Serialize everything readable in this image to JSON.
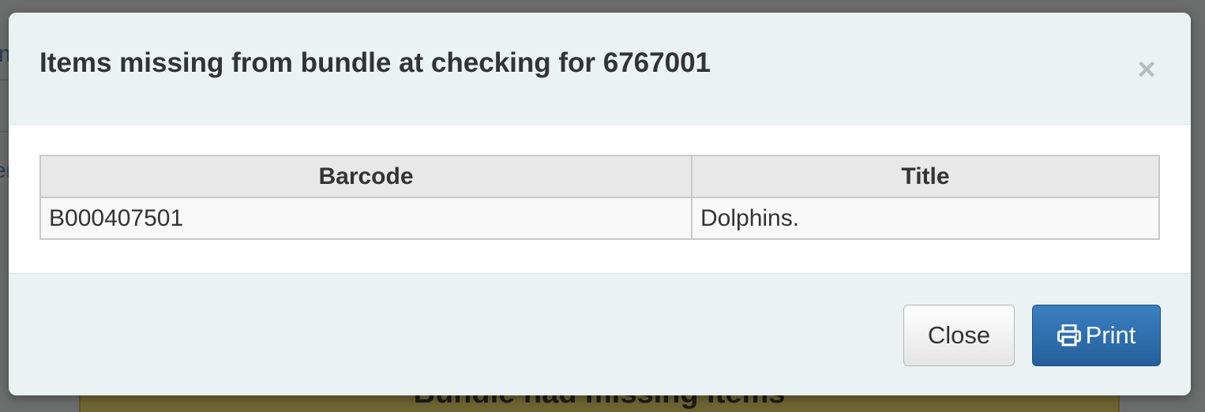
{
  "background": {
    "fragments": [
      "m",
      "er"
    ],
    "notice_text": "Bundle had missing items"
  },
  "modal": {
    "title": "Items missing from bundle at checking for 6767001",
    "close_icon": "×",
    "table": {
      "headers": [
        "Barcode",
        "Title"
      ],
      "rows": [
        [
          "B000407501",
          "Dolphins."
        ]
      ]
    },
    "footer": {
      "close_label": "Close",
      "print_label": "Print",
      "print_icon": "printer-icon"
    }
  },
  "colors": {
    "primary_button": "#2a6aa8",
    "header_background": "#eaf2f4",
    "overlay": "#6b6d6d"
  }
}
